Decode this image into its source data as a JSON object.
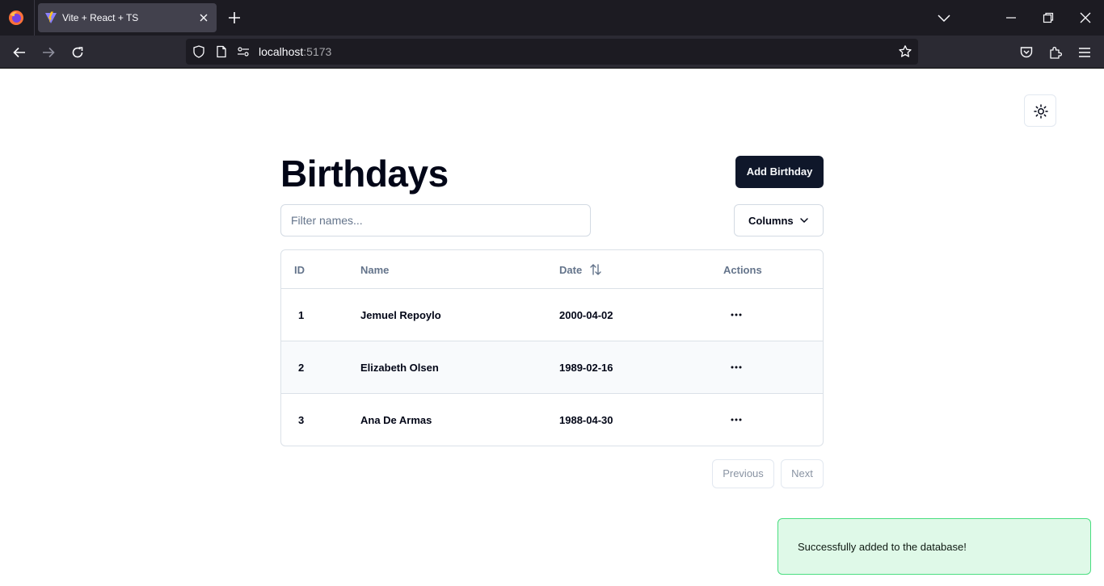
{
  "browser": {
    "tab": {
      "title": "Vite + React + TS"
    },
    "url": {
      "host": "localhost",
      "port": ":5173"
    }
  },
  "page": {
    "title": "Birthdays",
    "add_button": "Add Birthday",
    "filter": {
      "placeholder": "Filter names...",
      "value": ""
    },
    "columns_button": "Columns",
    "table": {
      "headers": {
        "id": "ID",
        "name": "Name",
        "date": "Date",
        "actions": "Actions"
      },
      "rows": [
        {
          "id": "1",
          "name": "Jemuel Repoylo",
          "date": "2000-04-02"
        },
        {
          "id": "2",
          "name": "Elizabeth Olsen",
          "date": "1989-02-16"
        },
        {
          "id": "3",
          "name": "Ana De Armas",
          "date": "1988-04-30"
        }
      ]
    },
    "pagination": {
      "previous": "Previous",
      "next": "Next"
    },
    "toast": {
      "message": "Successfully added to the database!"
    }
  },
  "colors": {
    "primary": "#0f172a",
    "toast_bg": "#dff9e8",
    "toast_border": "#4ade80",
    "row_alt": "#f8fafc"
  }
}
